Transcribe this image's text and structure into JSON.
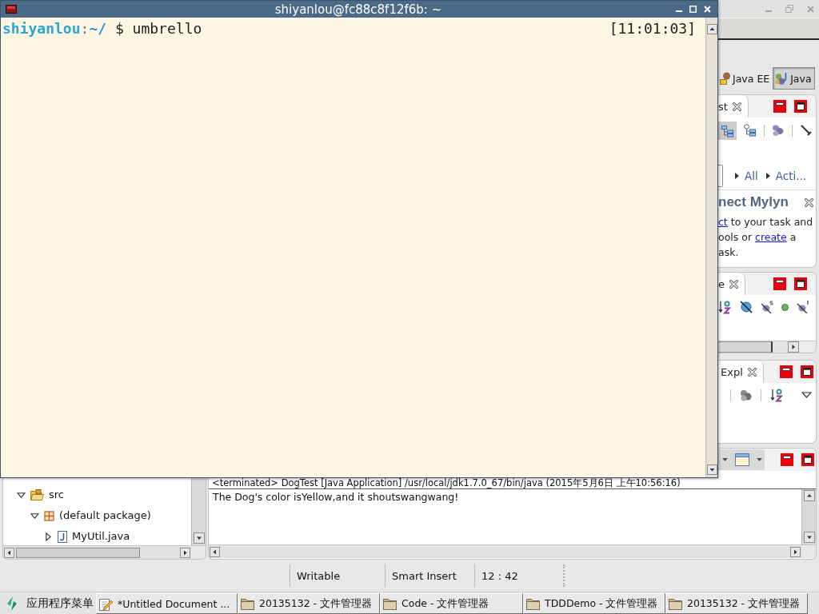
{
  "terminal": {
    "title": "shiyanlou@fc88c8f12f6b: ~",
    "prompt": {
      "user": "shiyanlou",
      "separator": ":",
      "path": "~/",
      "symbol": "$"
    },
    "command": "umbrello",
    "time": "[11:01:03]"
  },
  "eclipse": {
    "perspectives": [
      {
        "label": "Java EE",
        "kind": "javaee",
        "selected": false
      },
      {
        "label": "Java",
        "kind": "java",
        "selected": true
      }
    ],
    "task_list": {
      "tab": "st",
      "tools": [
        {
          "pressed": true
        },
        {
          "pressed": false
        },
        {
          "pressed": false
        },
        {
          "pressed": false
        }
      ],
      "filters": [
        "All",
        "Acti..."
      ],
      "heading": "nect Mylyn",
      "lines": [
        [
          {
            "text": "ct",
            "link": true
          },
          {
            "text": " to your task and",
            "link": false
          }
        ],
        [
          {
            "text": "ools or ",
            "link": false
          },
          {
            "text": "create",
            "link": true
          },
          {
            "text": " a",
            "link": false
          }
        ],
        [
          {
            "text": "ask.",
            "link": false
          }
        ]
      ]
    },
    "outline": {
      "tab": "e"
    },
    "explorer": {
      "tab": "Expl"
    },
    "package_tree": [
      {
        "label": "src",
        "kind": "source_folder",
        "expanded": true,
        "children": [
          {
            "label": "(default package)",
            "kind": "package",
            "expanded": true,
            "children": [
              {
                "label": "MyUtil.java",
                "kind": "java_file",
                "expanded": false
              }
            ]
          }
        ]
      }
    ],
    "console": {
      "header": "<terminated> DogTest [Java Application] /usr/local/jdk1.7.0_67/bin/java (2015年5月6日 上午10:56:16)",
      "output": "The Dog's color isYellow,and it shoutswangwang!"
    },
    "status_bar": [
      "Writable",
      "Smart Insert",
      "12 : 42"
    ]
  },
  "taskbar": {
    "menu": "应用程序菜单",
    "tasks": [
      {
        "label": "*Untitled Document ...",
        "kind": "editor"
      },
      {
        "label": "20135132 - 文件管理器",
        "kind": "folder"
      },
      {
        "label": "Code - 文件管理器",
        "kind": "folder"
      },
      {
        "label": "TDDDemo - 文件管理器",
        "kind": "folder"
      },
      {
        "label": "20135132 - 文件管理器",
        "kind": "folder"
      }
    ]
  }
}
